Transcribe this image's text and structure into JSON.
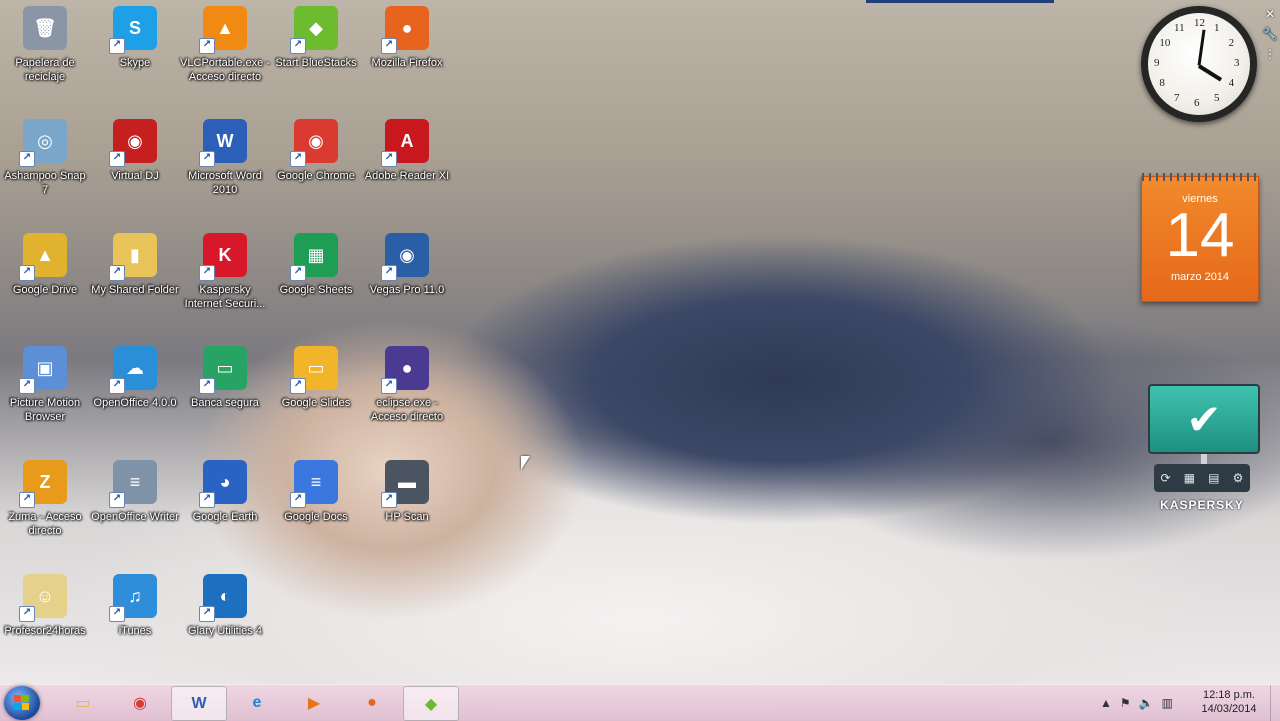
{
  "desktop_icons": [
    {
      "label": "Papelera de reciclaje",
      "icon": "recycle-bin-icon",
      "color": "#8a96a6",
      "glyph": "🗑",
      "shortcut": false
    },
    {
      "label": "Skype",
      "icon": "skype-icon",
      "color": "#1ea0e8",
      "glyph": "S",
      "shortcut": true
    },
    {
      "label": "VLCPortable.exe - Acceso directo",
      "icon": "vlc-icon",
      "color": "#f08a12",
      "glyph": "▲",
      "shortcut": true
    },
    {
      "label": "Start BlueStacks",
      "icon": "bluestacks-icon",
      "color": "#6dbb2f",
      "glyph": "◆",
      "shortcut": true
    },
    {
      "label": "Mozilla Firefox",
      "icon": "firefox-icon",
      "color": "#e8631d",
      "glyph": "●",
      "shortcut": true
    },
    {
      "label": "Ashampoo Snap 7",
      "icon": "ashampoo-snap-icon",
      "color": "#7aa7c9",
      "glyph": "◎",
      "shortcut": true
    },
    {
      "label": "Virtual DJ",
      "icon": "virtual-dj-icon",
      "color": "#c51f1f",
      "glyph": "◉",
      "shortcut": true
    },
    {
      "label": "Microsoft Word 2010",
      "icon": "word-icon",
      "color": "#2c5fb8",
      "glyph": "W",
      "shortcut": true
    },
    {
      "label": "Google Chrome",
      "icon": "chrome-icon",
      "color": "#d93b30",
      "glyph": "◉",
      "shortcut": true
    },
    {
      "label": "Adobe Reader XI",
      "icon": "adobe-reader-icon",
      "color": "#c8171d",
      "glyph": "A",
      "shortcut": true
    },
    {
      "label": "Google Drive",
      "icon": "google-drive-icon",
      "color": "#e0b22d",
      "glyph": "▲",
      "shortcut": true
    },
    {
      "label": "My Shared Folder",
      "icon": "folder-icon",
      "color": "#e8c35a",
      "glyph": "▮",
      "shortcut": true
    },
    {
      "label": "Kaspersky Internet Securi...",
      "icon": "kaspersky-icon",
      "color": "#d7182a",
      "glyph": "K",
      "shortcut": true
    },
    {
      "label": "Google Sheets",
      "icon": "google-sheets-icon",
      "color": "#1f9d55",
      "glyph": "▦",
      "shortcut": true
    },
    {
      "label": "Vegas Pro 11.0",
      "icon": "vegas-pro-icon",
      "color": "#2a5fa8",
      "glyph": "◉",
      "shortcut": true
    },
    {
      "label": "Picture Motion Browser",
      "icon": "picture-motion-icon",
      "color": "#5c8fd6",
      "glyph": "▣",
      "shortcut": true
    },
    {
      "label": "OpenOffice 4.0.0",
      "icon": "openoffice-icon",
      "color": "#2b8fd8",
      "glyph": "☁",
      "shortcut": true
    },
    {
      "label": "Banca segura",
      "icon": "banca-segura-icon",
      "color": "#27a463",
      "glyph": "▭",
      "shortcut": true
    },
    {
      "label": "Google Slides",
      "icon": "google-slides-icon",
      "color": "#f2b428",
      "glyph": "▭",
      "shortcut": true
    },
    {
      "label": "eclipse.exe - Acceso directo",
      "icon": "eclipse-icon",
      "color": "#4b3a91",
      "glyph": "●",
      "shortcut": true
    },
    {
      "label": "Zuma - Acceso directo",
      "icon": "zuma-icon",
      "color": "#e89b1a",
      "glyph": "Z",
      "shortcut": true
    },
    {
      "label": "OpenOffice Writer",
      "icon": "openoffice-writer-icon",
      "color": "#7f93a8",
      "glyph": "≡",
      "shortcut": true
    },
    {
      "label": "Google Earth",
      "icon": "google-earth-icon",
      "color": "#2b63c4",
      "glyph": "◕",
      "shortcut": true
    },
    {
      "label": "Google Docs",
      "icon": "google-docs-icon",
      "color": "#3a78e0",
      "glyph": "≡",
      "shortcut": true
    },
    {
      "label": "HP Scan",
      "icon": "hp-scan-icon",
      "color": "#4a5561",
      "glyph": "▬",
      "shortcut": true
    },
    {
      "label": "Profesor24horas",
      "icon": "profesor24horas-icon",
      "color": "#e6d18a",
      "glyph": "☺",
      "shortcut": true
    },
    {
      "label": "iTunes",
      "icon": "itunes-icon",
      "color": "#2e8ed9",
      "glyph": "♫",
      "shortcut": true
    },
    {
      "label": "Glary Utilities 4",
      "icon": "glary-utilities-icon",
      "color": "#1d6fc0",
      "glyph": "◐",
      "shortcut": true
    }
  ],
  "clock": {
    "numbers": [
      "12",
      "1",
      "2",
      "3",
      "4",
      "5",
      "6",
      "7",
      "8",
      "9",
      "10",
      "11"
    ]
  },
  "calendar": {
    "weekday": "viernes",
    "day": "14",
    "month_year": "marzo 2014"
  },
  "kaspersky_gadget": {
    "brand": "KASPERSKY"
  },
  "taskbar": {
    "pinned": [
      {
        "name": "explorer",
        "icon": "folder-icon",
        "glyph": "▭",
        "color": "#e3b84a"
      },
      {
        "name": "chrome",
        "icon": "chrome-icon",
        "glyph": "◉",
        "color": "#d93b30"
      },
      {
        "name": "word",
        "icon": "word-icon",
        "glyph": "W",
        "color": "#2c5fb8"
      },
      {
        "name": "internet-explorer",
        "icon": "ie-icon",
        "glyph": "e",
        "color": "#1d86d8"
      },
      {
        "name": "media-player",
        "icon": "media-player-icon",
        "glyph": "▶",
        "color": "#e8741a"
      },
      {
        "name": "firefox",
        "icon": "firefox-icon",
        "glyph": "●",
        "color": "#e8631d"
      },
      {
        "name": "bluestacks",
        "icon": "bluestacks-icon",
        "glyph": "◆",
        "color": "#6dbb2f"
      }
    ],
    "time": "12:18 p.m.",
    "date": "14/03/2014"
  }
}
